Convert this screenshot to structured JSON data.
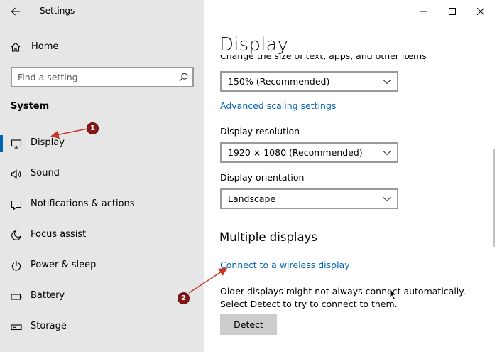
{
  "window": {
    "app_title": "Settings",
    "controls": [
      {
        "name": "minimize",
        "icon": "minimize-icon"
      },
      {
        "name": "maximize",
        "icon": "maximize-icon"
      },
      {
        "name": "close",
        "icon": "close-icon"
      }
    ]
  },
  "sidebar": {
    "home_label": "Home",
    "search_placeholder": "Find a setting",
    "section_title": "System",
    "items": [
      {
        "label": "Display",
        "icon": "monitor-icon",
        "selected": true
      },
      {
        "label": "Sound",
        "icon": "speaker-icon"
      },
      {
        "label": "Notifications & actions",
        "icon": "notification-icon"
      },
      {
        "label": "Focus assist",
        "icon": "moon-icon"
      },
      {
        "label": "Power & sleep",
        "icon": "power-icon"
      },
      {
        "label": "Battery",
        "icon": "battery-icon"
      },
      {
        "label": "Storage",
        "icon": "storage-icon"
      }
    ]
  },
  "main": {
    "title": "Display",
    "clipped_text": "Change the size of text, apps, and other items",
    "scale_value": "150% (Recommended)",
    "advanced_link": "Advanced scaling settings",
    "resolution_label": "Display resolution",
    "resolution_value": "1920 × 1080 (Recommended)",
    "orientation_label": "Display orientation",
    "orientation_value": "Landscape",
    "multiple_heading": "Multiple displays",
    "wireless_link": "Connect to a wireless display",
    "detect_text": "Older displays might not always connect automatically. Select Detect to try to connect to them.",
    "detect_button": "Detect"
  },
  "annotations": {
    "badges": [
      "1",
      "2"
    ],
    "color": "#8b1414"
  },
  "colors": {
    "accent": "#0063b1",
    "sidebar_bg": "#e6e6e6",
    "button_bg": "#cccccc"
  }
}
